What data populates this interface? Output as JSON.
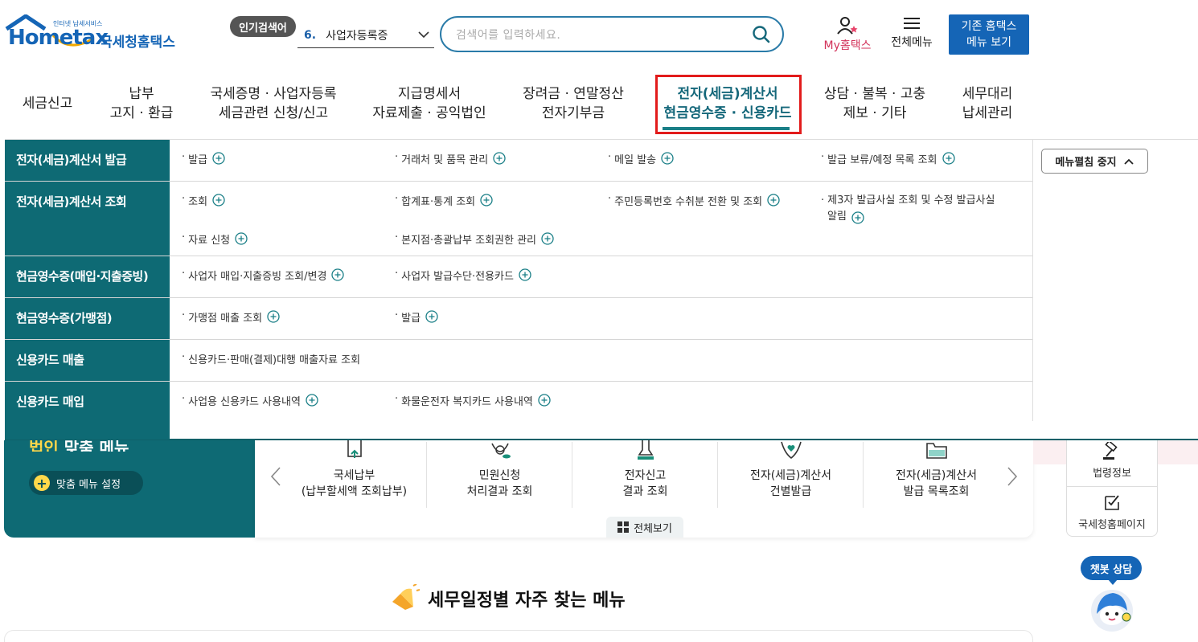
{
  "header": {
    "logo_small": "인터넷 납세서비스",
    "logo_main": "Hometax",
    "logo_org": "국세청홈택스",
    "popular_badge": "인기검색어",
    "popular_rank": "6.",
    "popular_term": "사업자등록증",
    "search_placeholder": "검색어를 입력하세요.",
    "my_label": "My홈택스",
    "all_menu_label": "전체메뉴",
    "old_menu_line1": "기존 홈택스",
    "old_menu_line2": "메뉴 보기"
  },
  "gnb": [
    {
      "line1": "세금신고",
      "line2": ""
    },
    {
      "line1": "납부",
      "line2": "고지 · 환급"
    },
    {
      "line1": "국세증명 · 사업자등록",
      "line2": "세금관련 신청/신고"
    },
    {
      "line1": "지급명세서",
      "line2": "자료제출 · 공익법인"
    },
    {
      "line1": "장려금 · 연말정산",
      "line2": "전자기부금"
    },
    {
      "line1": "전자(세금)계산서",
      "line2": "현금영수증 · 신용카드"
    },
    {
      "line1": "상담 · 불복 · 고충",
      "line2": "제보 · 기타"
    },
    {
      "line1": "세무대리",
      "line2": "납세관리"
    }
  ],
  "dropdown": {
    "stop_button": "메뉴펼침 중지",
    "rows": [
      {
        "category": "전자(세금)계산서 발급",
        "items": [
          "발급",
          "거래처 및 품목 관리",
          "메일 발송",
          "발급 보류/예정 목록 조회"
        ]
      },
      {
        "category": "전자(세금)계산서 조회",
        "items": [
          "조회",
          "합계표·통계 조회",
          "주민등록번호 수취분 전환 및 조회",
          "제3자 발급사실 조회 및 수정 발급사실",
          "알림",
          "자료 신청",
          "본지점·총괄납부 조회권한 관리"
        ]
      },
      {
        "category": "현금영수증(매입·지출증빙)",
        "items": [
          "사업자 매입·지출증빙 조회/변경",
          "사업자 발급수단·전용카드"
        ]
      },
      {
        "category": "현금영수증(가맹점)",
        "items": [
          "가맹점 매출 조회",
          "발급"
        ]
      },
      {
        "category": "신용카드 매출",
        "items": [
          "신용카드·판매(결제)대행 매출자료 조회"
        ]
      },
      {
        "category": "신용카드 매입",
        "items": [
          "사업용 신용카드 사용내역",
          "화물운전자 복지카드 사용내역"
        ]
      }
    ]
  },
  "custom_menu": {
    "title_a": "법인",
    "title_b": "맞춤 메뉴",
    "setting_button": "맞춤 메뉴 설정"
  },
  "quick_menu": [
    {
      "line1": "국세납부",
      "line2": "(납부할세액 조회납부)"
    },
    {
      "line1": "민원신청",
      "line2": "처리결과 조회"
    },
    {
      "line1": "전자신고",
      "line2": "결과 조회"
    },
    {
      "line1": "전자(세금)계산서",
      "line2": "건별발급"
    },
    {
      "line1": "전자(세금)계산서",
      "line2": "발급 목록조회"
    }
  ],
  "see_all": "전체보기",
  "side": {
    "law_info": "법령정보",
    "nts_page": "국세청홈페이지",
    "chatbot": "챗봇 상담"
  },
  "schedule_title": "세무일정별 자주 찾는 메뉴",
  "colors": {
    "teal": "#0e6a74",
    "blue": "#1565b6",
    "highlight_red": "#e21b1b",
    "yellow": "#ffd84a"
  }
}
